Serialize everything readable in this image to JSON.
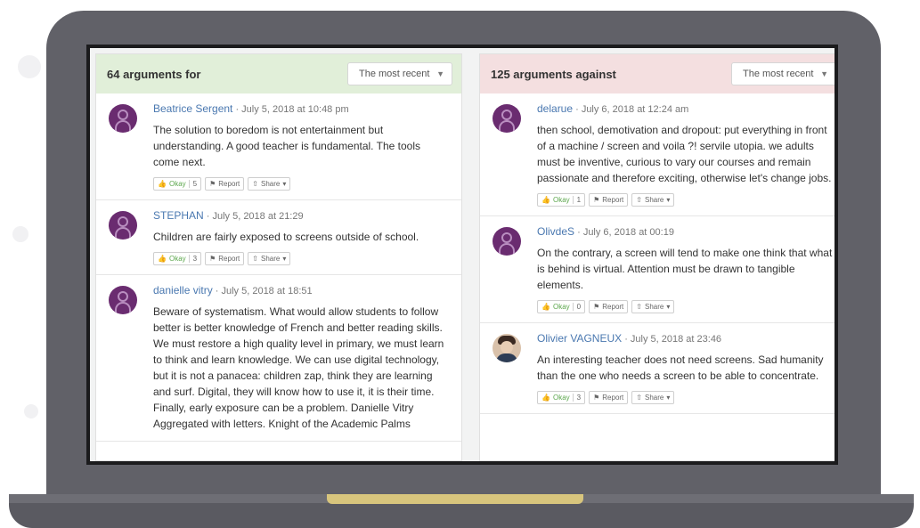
{
  "for_panel": {
    "title": "64 arguments for",
    "sort": "The most recent",
    "items": [
      {
        "author": "Beatrice Sergent",
        "date": "· July 5, 2018 at 10:48 pm",
        "text": "The solution to boredom is not entertainment but understanding. A good teacher is fundamental. The tools come next.",
        "okay": "Okay",
        "count": "5",
        "report": "Report",
        "share": "Share"
      },
      {
        "author": "STEPHAN",
        "date": "· July 5, 2018 at 21:29",
        "text": "Children are fairly exposed to screens outside of school.",
        "okay": "Okay",
        "count": "3",
        "report": "Report",
        "share": "Share"
      },
      {
        "author": "danielle vitry",
        "date": "· July 5, 2018 at 18:51",
        "text": "Beware of systematism. What would allow students to follow better is better knowledge of French and better reading skills. We must restore a high quality level in primary, we must learn to think and learn knowledge. We can use digital technology, but it is not a panacea: children zap, think they are learning and surf. Digital, they will know how to use it, it is their time. Finally, early exposure can be a problem. Danielle Vitry Aggregated with letters. Knight of the Academic Palms"
      }
    ]
  },
  "against_panel": {
    "title": "125 arguments against",
    "sort": "The most recent",
    "items": [
      {
        "author": "delarue",
        "date": "· July 6, 2018 at 12:24 am",
        "text": "then school, demotivation and dropout: put everything in front of a machine / screen and voila ?! servile utopia. we adults must be inventive, curious to vary our courses and remain passionate and therefore exciting, otherwise let's change jobs.",
        "okay": "Okay",
        "count": "1",
        "report": "Report",
        "share": "Share"
      },
      {
        "author": "OlivdeS",
        "date": "· July 6, 2018 at 00:19",
        "text": "On the contrary, a screen will tend to make one think that what is behind is virtual. Attention must be drawn to tangible elements.",
        "okay": "Okay",
        "count": "0",
        "report": "Report",
        "share": "Share"
      },
      {
        "author": "Olivier VAGNEUX",
        "date": "· July 5, 2018 at 23:46",
        "text": "An interesting teacher does not need screens. Sad humanity than the one who needs a screen to be able to concentrate.",
        "okay": "Okay",
        "count": "3",
        "report": "Report",
        "share": "Share"
      }
    ]
  },
  "colors": {
    "for_header": "#e1efd9",
    "against_header": "#f4dfe0",
    "avatar": "#6a2c70",
    "author_link": "#4a78b0",
    "laptop": "#616168",
    "hinge_accent": "#d8c57d"
  },
  "icons": {
    "okay": "thumbs-up-icon",
    "report": "flag-icon",
    "share": "share-icon",
    "sort": "chevron-down-icon",
    "avatar": "user-icon"
  }
}
